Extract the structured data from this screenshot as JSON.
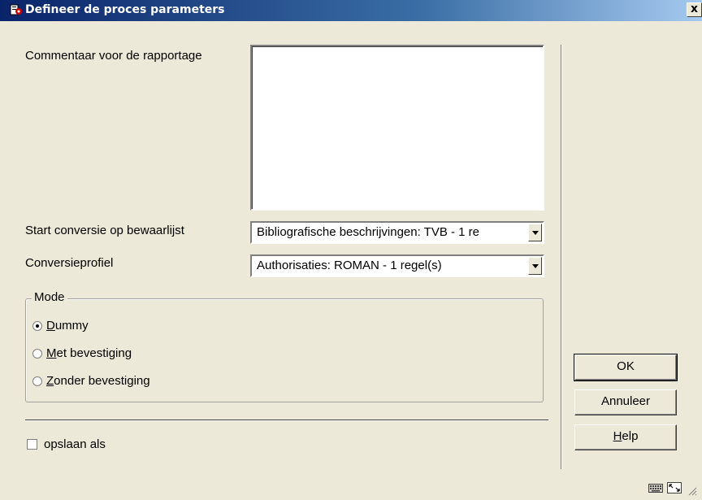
{
  "window": {
    "title": "Defineer de proces parameters",
    "close_symbol": "x"
  },
  "form": {
    "comment_label": "Commentaar voor de rapportage",
    "comment_value": "",
    "start_label": "Start conversie op bewaarlijst",
    "start_value": "Bibliografische beschrijvingen: TVB - 1 re",
    "profile_label": "Conversieprofiel",
    "profile_value": "Authorisaties: ROMAN - 1 regel(s)"
  },
  "mode": {
    "legend": "Mode",
    "options": [
      {
        "mnemonic": "D",
        "rest": "ummy",
        "selected": true
      },
      {
        "mnemonic": "M",
        "rest": "et bevestiging",
        "selected": false
      },
      {
        "mnemonic": "Z",
        "rest": "onder bevestiging",
        "selected": false
      }
    ]
  },
  "save_as": {
    "label": "opslaan als",
    "checked": false
  },
  "buttons": {
    "ok": "OK",
    "cancel": "Annuleer",
    "help_mnemonic": "H",
    "help_rest": "elp"
  },
  "icons": {
    "title": "app-icon",
    "statusbar": [
      "keyboard-icon",
      "resize-icon"
    ]
  }
}
